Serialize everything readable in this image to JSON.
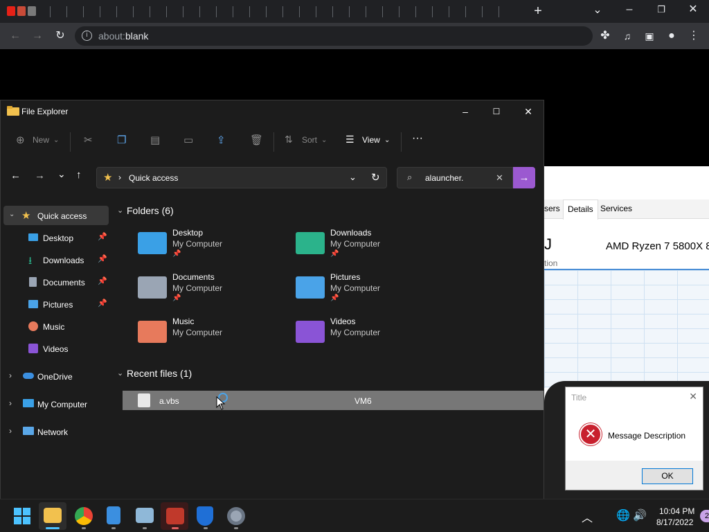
{
  "browser": {
    "url_prefix": "about:",
    "url_main": "blank",
    "new_tab_glyph": "+"
  },
  "task_manager": {
    "tabs": [
      "sers",
      "Details",
      "Services"
    ],
    "active_tab": "Details",
    "cpu_name": "AMD Ryzen 7 5800X 8",
    "cpu_letter": "J",
    "cpu_subtitle": "tion"
  },
  "explorer": {
    "title": "File Explorer",
    "commands": {
      "new": "New",
      "sort": "Sort",
      "view": "View",
      "more": "···"
    },
    "address": "Quick access",
    "search_value": "alauncher.",
    "nav": [
      {
        "label": "Quick access",
        "icon": "star-icon"
      },
      {
        "label": "Desktop",
        "icon": "desktop-icon",
        "pinned": true
      },
      {
        "label": "Downloads",
        "icon": "download-icon",
        "pinned": true
      },
      {
        "label": "Documents",
        "icon": "documents-icon",
        "pinned": true
      },
      {
        "label": "Pictures",
        "icon": "pictures-icon",
        "pinned": true
      },
      {
        "label": "Music",
        "icon": "music-icon"
      },
      {
        "label": "Videos",
        "icon": "videos-icon"
      },
      {
        "label": "OneDrive",
        "icon": "cloud-icon"
      },
      {
        "label": "My Computer",
        "icon": "computer-icon"
      },
      {
        "label": "Network",
        "icon": "network-icon"
      }
    ],
    "folders_header": "Folders (6)",
    "folders": [
      {
        "name": "Desktop",
        "location": "My Computer",
        "color": "#3aa0e6"
      },
      {
        "name": "Downloads",
        "location": "My Computer",
        "color": "#2bb38b"
      },
      {
        "name": "Documents",
        "location": "My Computer",
        "color": "#9aa5b4"
      },
      {
        "name": "Pictures",
        "location": "My Computer",
        "color": "#4aa3e8"
      },
      {
        "name": "Music",
        "location": "My Computer",
        "color": "#e77a5c"
      },
      {
        "name": "Videos",
        "location": "My Computer",
        "color": "#8a54d6"
      }
    ],
    "recent_header": "Recent files (1)",
    "recent": [
      {
        "name": "a.vbs",
        "location": "VM6"
      }
    ]
  },
  "message_box": {
    "title": "Title",
    "description": "Message Description",
    "ok_label": "OK"
  },
  "taskbar": {
    "time": "10:04 PM",
    "date": "8/17/2022",
    "notification_count": "2"
  }
}
